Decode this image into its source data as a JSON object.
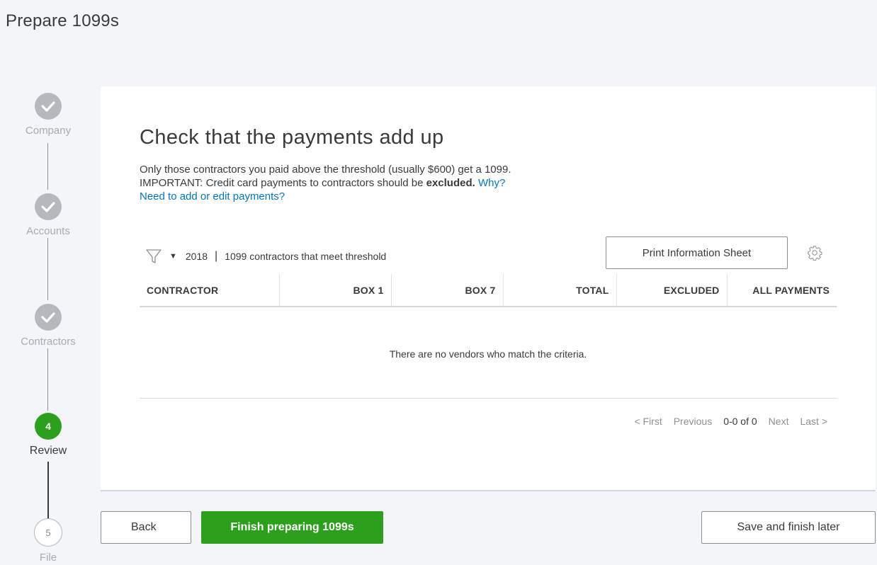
{
  "page": {
    "title": "Prepare 1099s"
  },
  "stepper": {
    "steps": [
      {
        "label": "Company",
        "state": "done"
      },
      {
        "label": "Accounts",
        "state": "done"
      },
      {
        "label": "Contractors",
        "state": "done"
      },
      {
        "label": "Review",
        "state": "current",
        "number": "4"
      },
      {
        "label": "File",
        "state": "todo",
        "number": "5"
      }
    ]
  },
  "main": {
    "heading": "Check that the payments add up",
    "line1": "Only those contractors you paid above the threshold (usually $600) get a 1099.",
    "line2_prefix": "IMPORTANT: Credit card payments to contractors should be ",
    "line2_bold": "excluded.",
    "why_link": "Why?",
    "edit_link": "Need to add or edit payments?"
  },
  "toolbar": {
    "filter_icon": "filter-icon",
    "year": "2018",
    "separator": "|",
    "filter_label": "1099 contractors that meet threshold",
    "print_button": "Print Information Sheet",
    "settings_icon": "gear-icon"
  },
  "table": {
    "columns": [
      "CONTRACTOR",
      "BOX 1",
      "BOX 7",
      "TOTAL",
      "EXCLUDED",
      "ALL PAYMENTS"
    ],
    "empty_message": "There are no vendors who match the criteria."
  },
  "pager": {
    "first": "< First",
    "previous": "Previous",
    "count": "0-0 of 0",
    "next": "Next",
    "last": "Last >"
  },
  "footer": {
    "back": "Back",
    "finish": "Finish preparing 1099s",
    "save": "Save and finish later"
  },
  "colors": {
    "accent_green": "#2ca01c",
    "link_blue": "#0077c5",
    "step_gray": "#b5b8bd"
  }
}
